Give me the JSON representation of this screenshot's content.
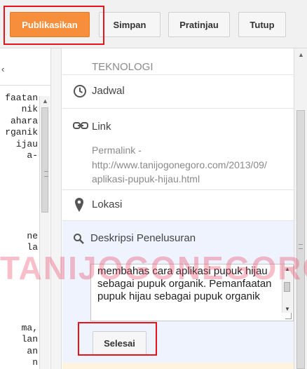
{
  "toolbar": {
    "publish_label": "Publikasikan",
    "save_label": "Simpan",
    "preview_label": "Pratinjau",
    "close_label": "Tutup"
  },
  "editor": {
    "lines": [
      "faatan",
      "nik",
      "ahara",
      "rganik",
      "ijau",
      "a-",
      "",
      "",
      "",
      "",
      "",
      "",
      "ne",
      "la",
      "",
      "",
      "",
      "",
      "",
      "",
      "ma,",
      "lan",
      "an",
      "n"
    ]
  },
  "settings": {
    "labels_value": "TEKNOLOGI",
    "schedule": {
      "label": "Jadwal",
      "icon": "clock-icon"
    },
    "link": {
      "label": "Link",
      "icon": "link-icon",
      "permalink_label": "Permalink -",
      "permalink_line1": "http://www.tanijogonegoro.com/2013/09/",
      "permalink_line2": "aplikasi-pupuk-hijau.html"
    },
    "location": {
      "label": "Lokasi",
      "icon": "location-pin-icon"
    },
    "search_description": {
      "label": "Deskripsi Penelusuran",
      "icon": "search-icon",
      "text": "membahas cara aplikasi pupuk hijau sebagai pupuk organik. Pemanfaatan pupuk hijau sebagai pupuk organik"
    },
    "done_label": "Selesai"
  },
  "watermark": "TANIJOGONEGORO",
  "colors": {
    "primary_button": "#f68e3b",
    "highlight_box": "#e8141a",
    "search_section_bg": "#eef3fd"
  }
}
